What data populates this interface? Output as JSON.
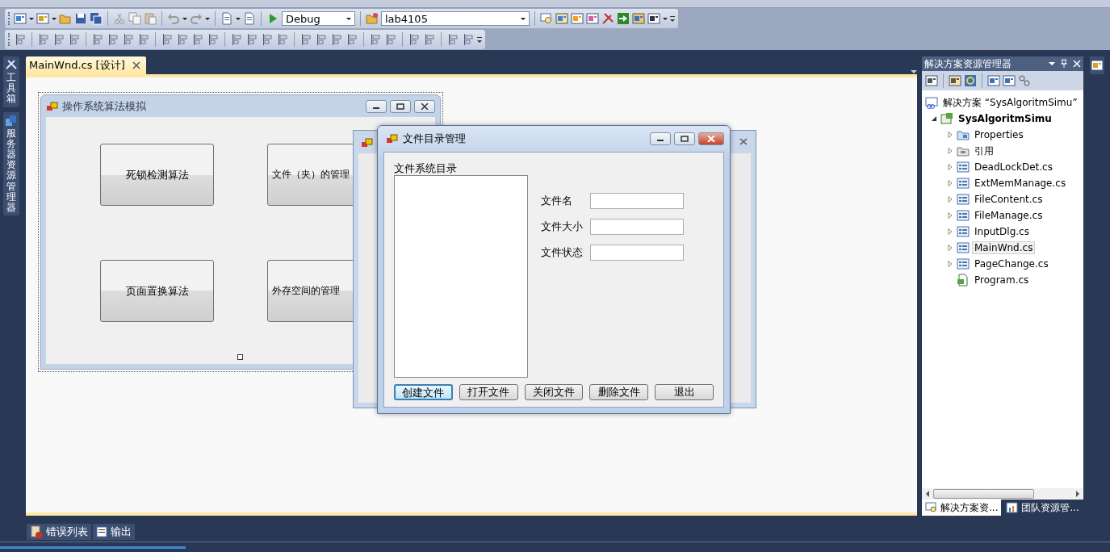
{
  "toolbar": {
    "configuration": "Debug",
    "startup_project": "lab4105"
  },
  "side_tabs": [
    {
      "label": "工具箱"
    },
    {
      "label": "服务器资源管理器"
    }
  ],
  "document_tabs": [
    {
      "label": "MainWnd.cs [设计]",
      "selected": true
    }
  ],
  "designer_form": {
    "title": "操作系统算法模拟",
    "buttons": [
      {
        "label": "死锁检测算法",
        "kind": "full"
      },
      {
        "label": "文件（夹）的管理",
        "kind": "covered"
      },
      {
        "label": "页面置换算法",
        "kind": "full"
      },
      {
        "label": "外存空间的管理",
        "kind": "covered"
      }
    ]
  },
  "dialog": {
    "title": "文件目录管理",
    "list_label": "文件系统目录",
    "fields": [
      {
        "label": "文件名"
      },
      {
        "label": "文件大小"
      },
      {
        "label": "文件状态"
      }
    ],
    "buttons": [
      {
        "label": "创建文件",
        "focused": true
      },
      {
        "label": "打开文件",
        "focused": false
      },
      {
        "label": "关闭文件",
        "focused": false
      },
      {
        "label": "删除文件",
        "focused": false
      },
      {
        "label": "退出",
        "focused": false
      }
    ]
  },
  "solution_explorer": {
    "title": "解决方案资源管理器",
    "tree": [
      {
        "label": "解决方案 “SysAlgoritmSimu”",
        "kind": "solution",
        "selected": false,
        "children": [
          {
            "label": "SysAlgoritmSimu",
            "kind": "project",
            "expanded": true,
            "selected": false,
            "children": [
              {
                "label": "Properties",
                "kind": "properties",
                "expanded": false,
                "selected": false
              },
              {
                "label": "引用",
                "kind": "references",
                "expanded": false,
                "selected": false
              },
              {
                "label": "DeadLockDet.cs",
                "kind": "form",
                "expanded": false,
                "selected": false
              },
              {
                "label": "ExtMemManage.cs",
                "kind": "form",
                "expanded": false,
                "selected": false
              },
              {
                "label": "FileContent.cs",
                "kind": "form",
                "expanded": false,
                "selected": false
              },
              {
                "label": "FileManage.cs",
                "kind": "form",
                "expanded": false,
                "selected": false
              },
              {
                "label": "InputDlg.cs",
                "kind": "form",
                "expanded": false,
                "selected": false
              },
              {
                "label": "MainWnd.cs",
                "kind": "form",
                "expanded": false,
                "selected": true
              },
              {
                "label": "PageChange.cs",
                "kind": "form",
                "expanded": false,
                "selected": false
              },
              {
                "label": "Program.cs",
                "kind": "code",
                "selected": false
              }
            ]
          }
        ]
      }
    ],
    "tabs": [
      {
        "label": "解决方案资...",
        "selected": true
      },
      {
        "label": "团队资源管...",
        "selected": false
      }
    ]
  },
  "bottom_tabs": [
    {
      "label": "错误列表",
      "kind": "errors"
    },
    {
      "label": "输出",
      "kind": "output"
    }
  ]
}
